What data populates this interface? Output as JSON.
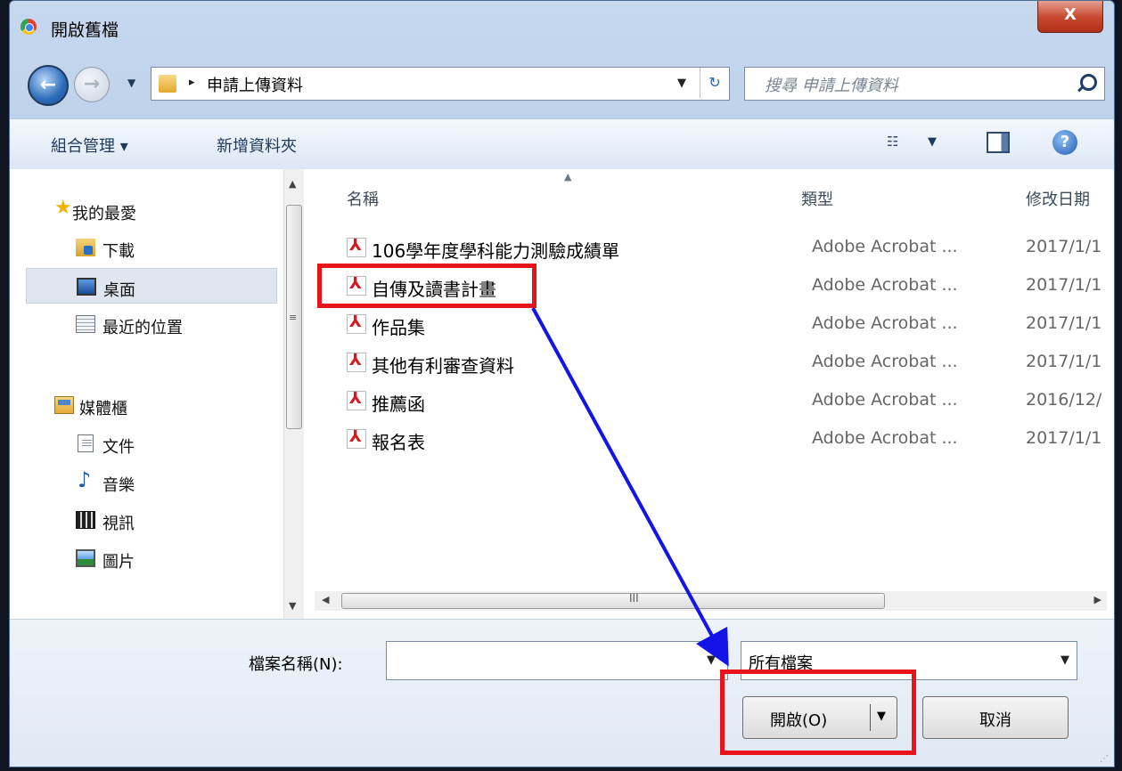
{
  "window": {
    "title": "開啟舊檔",
    "close_label": "X"
  },
  "address": {
    "current_folder": "申請上傳資料"
  },
  "search": {
    "placeholder": "搜尋 申請上傳資料"
  },
  "toolbar": {
    "organize": "組合管理 ▾",
    "new_folder": "新增資料夾"
  },
  "nav": {
    "favorites": "我的最愛",
    "downloads": "下載",
    "desktop": "桌面",
    "recent": "最近的位置",
    "libraries": "媒體櫃",
    "documents": "文件",
    "music": "音樂",
    "videos": "視訊",
    "pictures": "圖片"
  },
  "columns": {
    "name": "名稱",
    "type": "類型",
    "modified": "修改日期"
  },
  "files": [
    {
      "name": "106學年度學科能力測驗成績單",
      "type": "Adobe Acrobat ...",
      "date": "2017/1/1"
    },
    {
      "name": "自傳及讀書計畫",
      "type": "Adobe Acrobat ...",
      "date": "2017/1/1"
    },
    {
      "name": "作品集",
      "type": "Adobe Acrobat ...",
      "date": "2017/1/1"
    },
    {
      "name": "其他有利審查資料",
      "type": "Adobe Acrobat ...",
      "date": "2017/1/1"
    },
    {
      "name": "推薦函",
      "type": "Adobe Acrobat ...",
      "date": "2016/12/"
    },
    {
      "name": "報名表",
      "type": "Adobe Acrobat ...",
      "date": "2017/1/1"
    }
  ],
  "filename": {
    "label": "檔案名稱(N):",
    "value": ""
  },
  "filetype": {
    "selected": "所有檔案"
  },
  "buttons": {
    "open": "開啟(O)",
    "cancel": "取消"
  },
  "colors": {
    "highlight": "#e8141a",
    "annotation_arrow": "#1414e8"
  }
}
